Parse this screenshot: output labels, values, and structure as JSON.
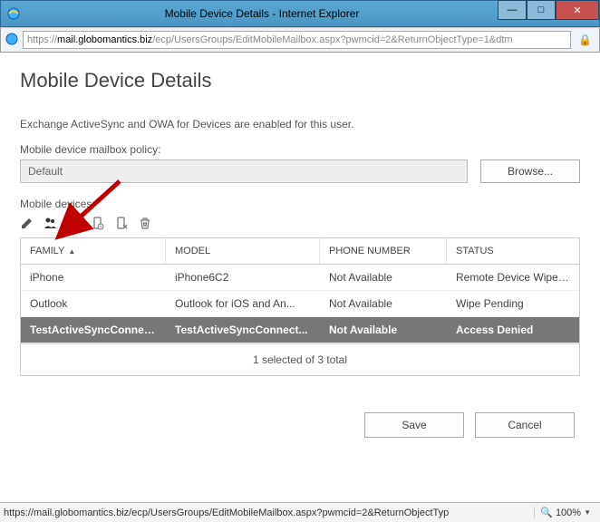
{
  "window": {
    "title": "Mobile Device Details - Internet Explorer"
  },
  "address_bar": {
    "protocol": "https://",
    "host": "mail.globomantics.biz",
    "path": "/ecp/UsersGroups/EditMobileMailbox.aspx?pwmcid=2&ReturnObjectType=1&dtm"
  },
  "page": {
    "heading": "Mobile Device Details",
    "info": "Exchange ActiveSync and OWA for Devices are enabled for this user.",
    "policy_label": "Mobile device mailbox policy:",
    "policy_value": "Default",
    "browse_label": "Browse...",
    "devices_label": "Mobile devices:"
  },
  "toolbar_icons": [
    "edit",
    "block",
    "allow",
    "wipe-device",
    "wipe-account",
    "delete"
  ],
  "grid": {
    "columns": {
      "family": "FAMILY",
      "model": "MODEL",
      "phone": "PHONE NUMBER",
      "status": "STATUS"
    },
    "rows": [
      {
        "family": "iPhone",
        "model": "iPhone6C2",
        "phone": "Not Available",
        "status": "Remote Device Wipe Su...",
        "selected": false
      },
      {
        "family": "Outlook",
        "model": "Outlook for iOS and An...",
        "phone": "Not Available",
        "status": "Wipe Pending",
        "selected": false
      },
      {
        "family": "TestActiveSyncConnect...",
        "model": "TestActiveSyncConnect...",
        "phone": "Not Available",
        "status": "Access Denied",
        "selected": true
      }
    ],
    "footer": "1 selected of 3 total"
  },
  "actions": {
    "save": "Save",
    "cancel": "Cancel"
  },
  "statusbar": {
    "url": "https://mail.globomantics.biz/ecp/UsersGroups/EditMobileMailbox.aspx?pwmcid=2&ReturnObjectTyp",
    "zoom": "100%"
  }
}
